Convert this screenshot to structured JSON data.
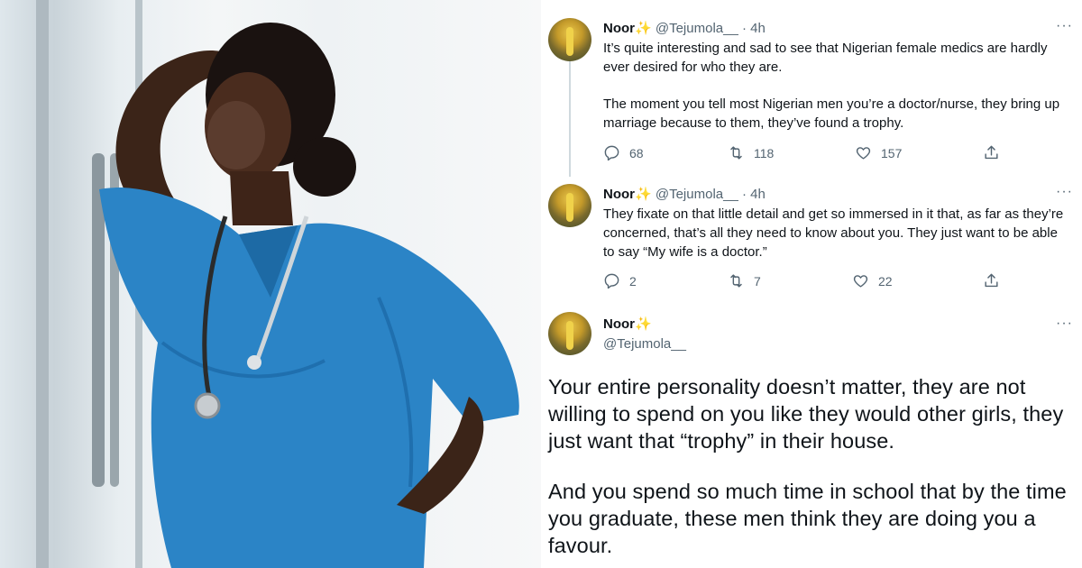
{
  "photo": {
    "alt": "Nurse in blue scrubs with a stethoscope, hand on forehead, looking out a window"
  },
  "tweets": [
    {
      "name": "Noor",
      "emoji": "✨",
      "handle": "@Tejumola__",
      "time": "· 4h",
      "more": "···",
      "text_p1": "It’s quite interesting and sad to see that Nigerian female medics are hardly ever desired for who they are.",
      "text_p2": "The moment you tell most Nigerian men you’re a doctor/nurse, they bring up marriage because to them, they’ve found a trophy.",
      "replies": "68",
      "retweets": "118",
      "likes": "157"
    },
    {
      "name": "Noor",
      "emoji": "✨",
      "handle": "@Tejumola__",
      "time": "· 4h",
      "more": "···",
      "text_p1": "They fixate on that little detail and get so immersed in it that, as far as they’re concerned, that’s all they need to know about you. They just want to be able to say “My wife is a doctor.”",
      "replies": "2",
      "retweets": "7",
      "likes": "22"
    },
    {
      "name": "Noor",
      "emoji": "✨",
      "handle": "@Tejumola__",
      "more": "···",
      "text_p1": "Your entire personality doesn’t matter, they are not willing to spend on you like they would other girls, they just want that “trophy” in their house.",
      "text_p2": "And you spend so much time in school that by the time you graduate, these men think they are doing you a favour."
    }
  ],
  "icons": {
    "reply": "reply-icon",
    "retweet": "retweet-icon",
    "like": "heart-icon",
    "share": "share-icon",
    "accent": "#536471",
    "sparkle_color": "#f4b400"
  }
}
